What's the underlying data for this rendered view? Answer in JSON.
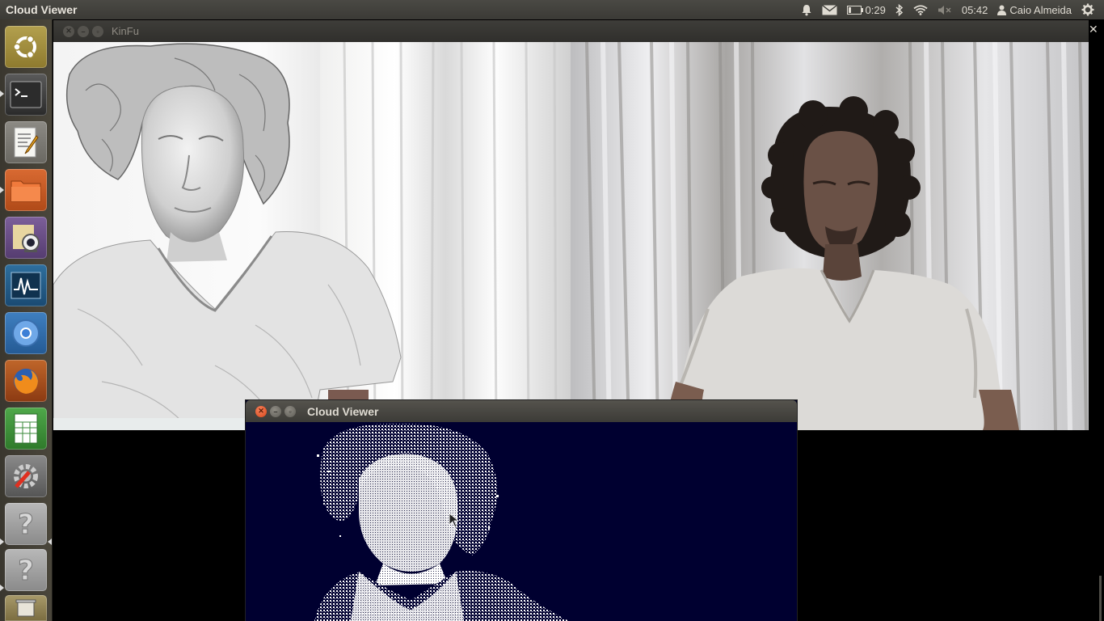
{
  "top_panel": {
    "app_title": "Cloud Viewer",
    "battery_time": "0:29",
    "clock": "05:42",
    "user_name": "Caio Almeida"
  },
  "launcher": {
    "items": [
      {
        "name": "dash-home",
        "icon": "ubuntu-logo-icon"
      },
      {
        "name": "terminal",
        "icon": "terminal-icon"
      },
      {
        "name": "text-editor",
        "icon": "text-editor-icon"
      },
      {
        "name": "files",
        "icon": "folder-icon"
      },
      {
        "name": "cheese-webcam",
        "icon": "webcam-icon"
      },
      {
        "name": "system-monitor",
        "icon": "system-monitor-icon"
      },
      {
        "name": "chromium",
        "icon": "chromium-icon"
      },
      {
        "name": "firefox",
        "icon": "firefox-icon"
      },
      {
        "name": "spreadsheet",
        "icon": "spreadsheet-icon"
      },
      {
        "name": "system-settings",
        "icon": "settings-icon"
      },
      {
        "name": "unknown-app-1",
        "icon": "question-mark-icon"
      },
      {
        "name": "unknown-app-2",
        "icon": "question-mark-icon"
      },
      {
        "name": "trash",
        "icon": "trash-icon"
      }
    ]
  },
  "kinfu_window": {
    "title": "KinFu"
  },
  "cloud_viewer_window": {
    "title": "Cloud Viewer"
  },
  "colors": {
    "panel_bg": "#3c3b37",
    "cloud_bg": "#000030",
    "close_orange": "#e85a2a"
  }
}
